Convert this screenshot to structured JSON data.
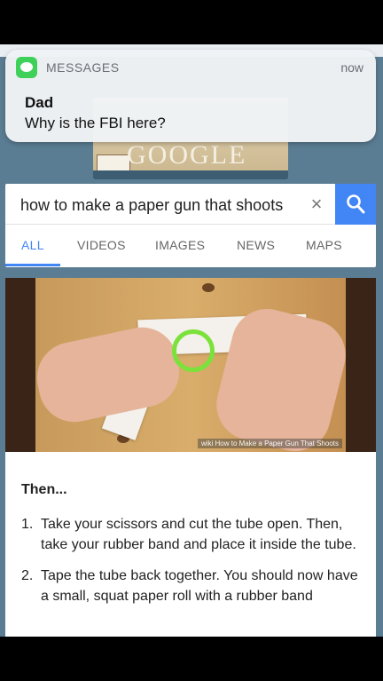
{
  "notification": {
    "app_name": "MESSAGES",
    "time": "now",
    "sender": "Dad",
    "message": "Why is the FBI here?"
  },
  "doodle": {
    "word": "GOOGLE"
  },
  "search": {
    "query": "how to make a paper gun that shoots",
    "clear_icon": "×",
    "tabs": [
      "ALL",
      "VIDEOS",
      "IMAGES",
      "NEWS",
      "MAPS"
    ],
    "active_tab": "ALL"
  },
  "result": {
    "video_caption": "wiki How to Make a Paper Gun That Shoots",
    "heading": "Then...",
    "steps": [
      {
        "num": "1.",
        "text": "Take your scissors and cut the tube open. Then, take your rubber band and place it inside the tube."
      },
      {
        "num": "2.",
        "text": "Tape the tube back together. You should now have a small, squat paper roll with a rubber band"
      }
    ]
  },
  "colors": {
    "accent": "#4285f4",
    "messages_green": "#3fd05a",
    "ring": "#7ae23a"
  }
}
